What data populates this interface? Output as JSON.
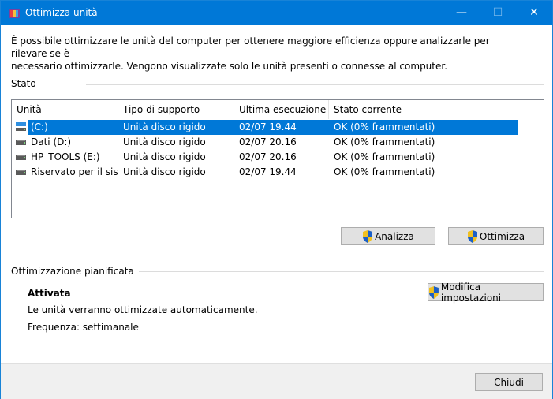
{
  "window": {
    "title": "Ottimizza unità",
    "minimize": "—",
    "maximize": "☐",
    "close": "✕"
  },
  "intro": {
    "line1": "È possibile ottimizzare le unità del computer per ottenere maggiore efficienza oppure analizzarle per rilevare se è",
    "line2": "necessario ottimizzarle. Vengono visualizzate solo le unità presenti o connesse al computer."
  },
  "status": {
    "group_label": "Stato",
    "columns": [
      "Unità",
      "Tipo di supporto",
      "Ultima esecuzione",
      "Stato corrente"
    ],
    "rows": [
      {
        "drive": "(C:)",
        "media": "Unità disco rigido",
        "last_run": "02/07 19.44",
        "status": "OK (0% frammentati)",
        "selected": true,
        "icon": "system-drive-icon"
      },
      {
        "drive": "Dati (D:)",
        "media": "Unità disco rigido",
        "last_run": "02/07 20.16",
        "status": "OK (0% frammentati)",
        "selected": false,
        "icon": "hard-drive-icon"
      },
      {
        "drive": "HP_TOOLS (E:)",
        "media": "Unità disco rigido",
        "last_run": "02/07 20.16",
        "status": "OK (0% frammentati)",
        "selected": false,
        "icon": "hard-drive-icon"
      },
      {
        "drive": "Riservato per il sist",
        "media": "Unità disco rigido",
        "last_run": "02/07 19.44",
        "status": "OK (0% frammentati)",
        "selected": false,
        "icon": "hard-drive-icon"
      }
    ],
    "analyze_label": "Analizza",
    "optimize_label": "Ottimizza"
  },
  "schedule": {
    "group_label": "Ottimizzazione pianificata",
    "state": "Attivata",
    "description": "Le unità verranno ottimizzate automaticamente.",
    "frequency": "Frequenza: settimanale",
    "change_settings_label": "Modifica impostazioni"
  },
  "footer": {
    "close_label": "Chiudi"
  },
  "colors": {
    "titlebar": "#0078d7",
    "selection": "#0078d7"
  }
}
